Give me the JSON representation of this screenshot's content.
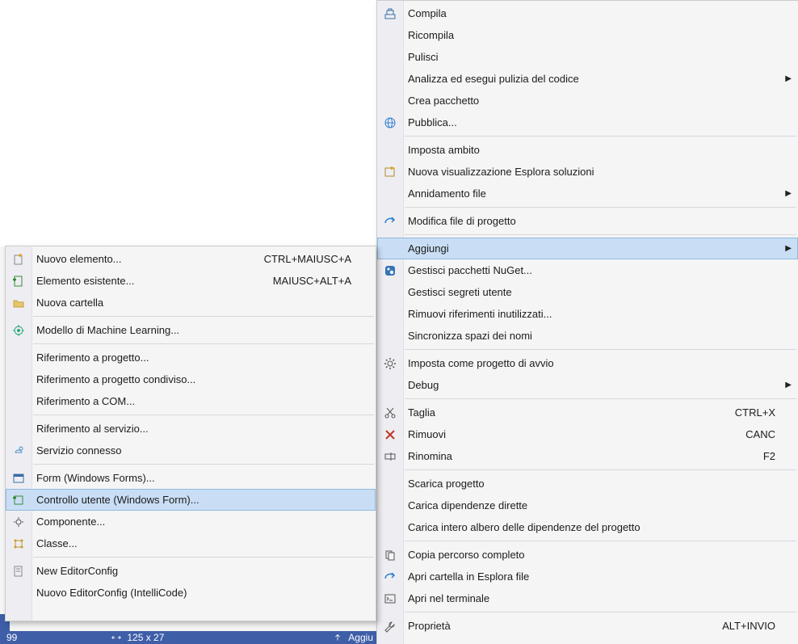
{
  "submenu": {
    "nuovo_elemento": "Nuovo elemento...",
    "nuovo_elemento_shortcut": "CTRL+MAIUSC+A",
    "elemento_esistente": "Elemento esistente...",
    "elemento_esistente_shortcut": "MAIUSC+ALT+A",
    "nuova_cartella": "Nuova cartella",
    "ml_model": "Modello di Machine Learning...",
    "rif_progetto": "Riferimento a progetto...",
    "rif_progetto_condiviso": "Riferimento a progetto condiviso...",
    "rif_com": "Riferimento a COM...",
    "rif_servizio": "Riferimento al servizio...",
    "servizio_connesso": "Servizio connesso",
    "form_wf": "Form (Windows Forms)...",
    "controllo_utente": "Controllo utente (Windows Form)...",
    "componente": "Componente...",
    "classe": "Classe...",
    "new_editorconfig": "New EditorConfig",
    "nuovo_editorconfig": "Nuovo EditorConfig (IntelliCode)"
  },
  "mainmenu": {
    "compila": "Compila",
    "ricompila": "Ricompila",
    "pulisci": "Pulisci",
    "analizza": "Analizza ed esegui pulizia del codice",
    "crea_pacchetto": "Crea pacchetto",
    "pubblica": "Pubblica...",
    "imposta_ambito": "Imposta ambito",
    "nuova_vis": "Nuova visualizzazione Esplora soluzioni",
    "annidamento": "Annidamento file",
    "modifica_file": "Modifica file di progetto",
    "aggiungi": "Aggiungi",
    "gestisci_nuget": "Gestisci pacchetti NuGet...",
    "gestisci_segreti": "Gestisci segreti utente",
    "rimuovi_rif": "Rimuovi riferimenti inutilizzati...",
    "sync_ns": "Sincronizza spazi dei nomi",
    "imposta_avvio": "Imposta come progetto di avvio",
    "debug": "Debug",
    "taglia": "Taglia",
    "taglia_shortcut": "CTRL+X",
    "rimuovi": "Rimuovi",
    "rimuovi_shortcut": "CANC",
    "rinomina": "Rinomina",
    "rinomina_shortcut": "F2",
    "scarica": "Scarica progetto",
    "carica_dirette": "Carica dipendenze dirette",
    "carica_albero": "Carica intero albero delle dipendenze del progetto",
    "copia_percorso": "Copia percorso completo",
    "apri_cartella": "Apri cartella in Esplora file",
    "apri_terminale": "Apri nel terminale",
    "proprieta": "Proprietà",
    "proprieta_shortcut": "ALT+INVIO"
  },
  "status": {
    "num": "99",
    "size": "125 x 27",
    "aggiu": "Aggiu"
  },
  "toptab": {
    "label": ""
  }
}
